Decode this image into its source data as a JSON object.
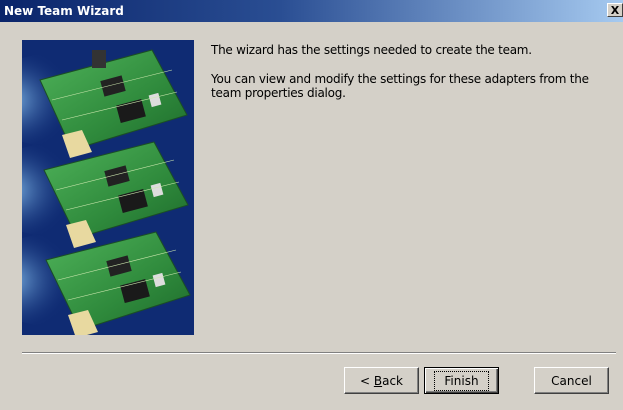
{
  "window": {
    "title": "New Team Wizard",
    "close_glyph": "X"
  },
  "banner": {
    "icon": "network-adapter-cards-image"
  },
  "content": {
    "paragraph1": "The wizard has the settings needed to create the team.",
    "paragraph2": "You can view and modify the settings for these adapters from the team properties dialog."
  },
  "buttons": {
    "back_prefix": "< ",
    "back_mnemonic": "B",
    "back_rest": "ack",
    "finish": "Finish",
    "cancel": "Cancel"
  },
  "colors": {
    "titlebar_start": "#0a246a",
    "titlebar_end": "#a6caf0",
    "dialog_face": "#d4d0c8",
    "banner_bg": "#0f2b73",
    "pcb_green": "#2f8a3c"
  }
}
